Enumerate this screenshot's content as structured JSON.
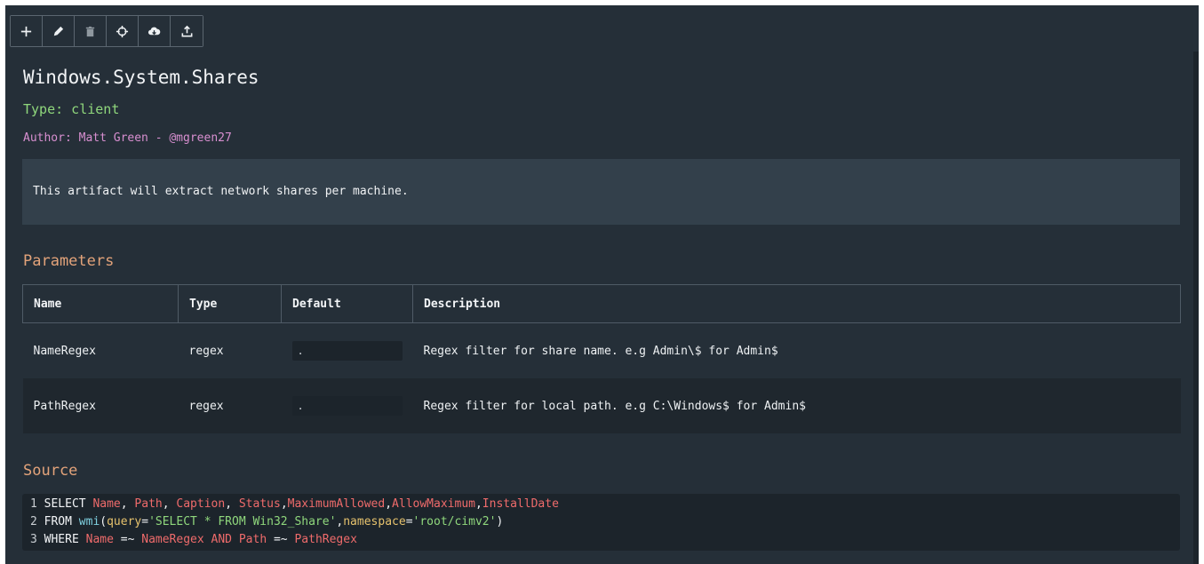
{
  "toolbar": {
    "buttons": [
      {
        "icon": "plus-icon"
      },
      {
        "icon": "pencil-icon"
      },
      {
        "icon": "trash-icon"
      },
      {
        "icon": "crosshair-icon"
      },
      {
        "icon": "cloud-download-icon"
      },
      {
        "icon": "upload-icon"
      }
    ]
  },
  "artifact": {
    "name": "Windows.System.Shares",
    "type": "Type: client",
    "author": "Author: Matt Green - @mgreen27",
    "description": "This artifact will extract network shares per machine."
  },
  "parameters": {
    "heading": "Parameters",
    "columns": [
      "Name",
      "Type",
      "Default",
      "Description"
    ],
    "rows": [
      {
        "name": "NameRegex",
        "type": "regex",
        "default": ".",
        "description": "Regex filter for share name. e.g Admin\\$ for Admin$"
      },
      {
        "name": "PathRegex",
        "type": "regex",
        "default": ".",
        "description": "Regex filter for local path. e.g C:\\Windows$ for Admin$"
      }
    ]
  },
  "source": {
    "heading": "Source",
    "lines": [
      {
        "num": "1",
        "kw1": "SELECT",
        "t1": "Name",
        "p1": ", ",
        "t2": "Path",
        "p2": ", ",
        "t3": "Caption",
        "p3": ", ",
        "t4": "Status",
        "p4": ",",
        "t5": "MaximumAllowed",
        "p5": ",",
        "t6": "AllowMaximum",
        "p6": ",",
        "t7": "InstallDate"
      },
      {
        "num": "2",
        "kw1": "FROM",
        "fn": "wmi",
        "open": "(",
        "a1": "query",
        "eq1": "=",
        "s1": "'SELECT * FROM Win32_Share'",
        "comma": ",",
        "a2": "namespace",
        "eq2": "=",
        "s2": "'root/cimv2'",
        "close": ")"
      },
      {
        "num": "3",
        "kw1": "WHERE",
        "t1": "Name",
        "op1": " =~ ",
        "t2": "NameRegex",
        "kw2": " AND ",
        "t3": "Path",
        "op2": " =~ ",
        "t4": "PathRegex"
      }
    ]
  },
  "colors": {
    "background": "#252f38",
    "type_green": "#8fd77c",
    "author_purple": "#d88fd0",
    "heading_orange": "#e3a37a",
    "identifier_red": "#ef6b6b"
  }
}
